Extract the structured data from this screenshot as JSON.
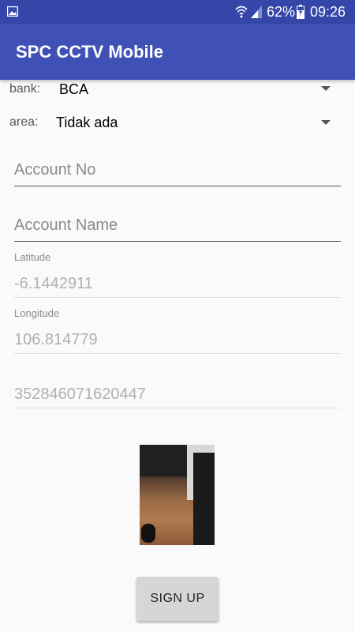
{
  "status_bar": {
    "battery_percent": "62%",
    "time": "09:26",
    "icons": [
      "image-icon",
      "wifi-icon",
      "signal-icon",
      "battery-charging-icon"
    ]
  },
  "app_bar": {
    "title": "SPC CCTV Mobile",
    "color": "#3f51b5"
  },
  "form": {
    "bank": {
      "label": "bank:",
      "value": "BCA"
    },
    "area": {
      "label": "area:",
      "value": "Tidak ada"
    },
    "account_no": {
      "placeholder": "Account No",
      "value": ""
    },
    "account_name": {
      "placeholder": "Account Name",
      "value": ""
    },
    "latitude": {
      "label": "Latitude",
      "value": "-6.1442911"
    },
    "longitude": {
      "label": "Longitude",
      "value": "106.814779"
    },
    "device_id": {
      "value": "352846071620447"
    }
  },
  "actions": {
    "signup_label": "SIGN UP"
  }
}
